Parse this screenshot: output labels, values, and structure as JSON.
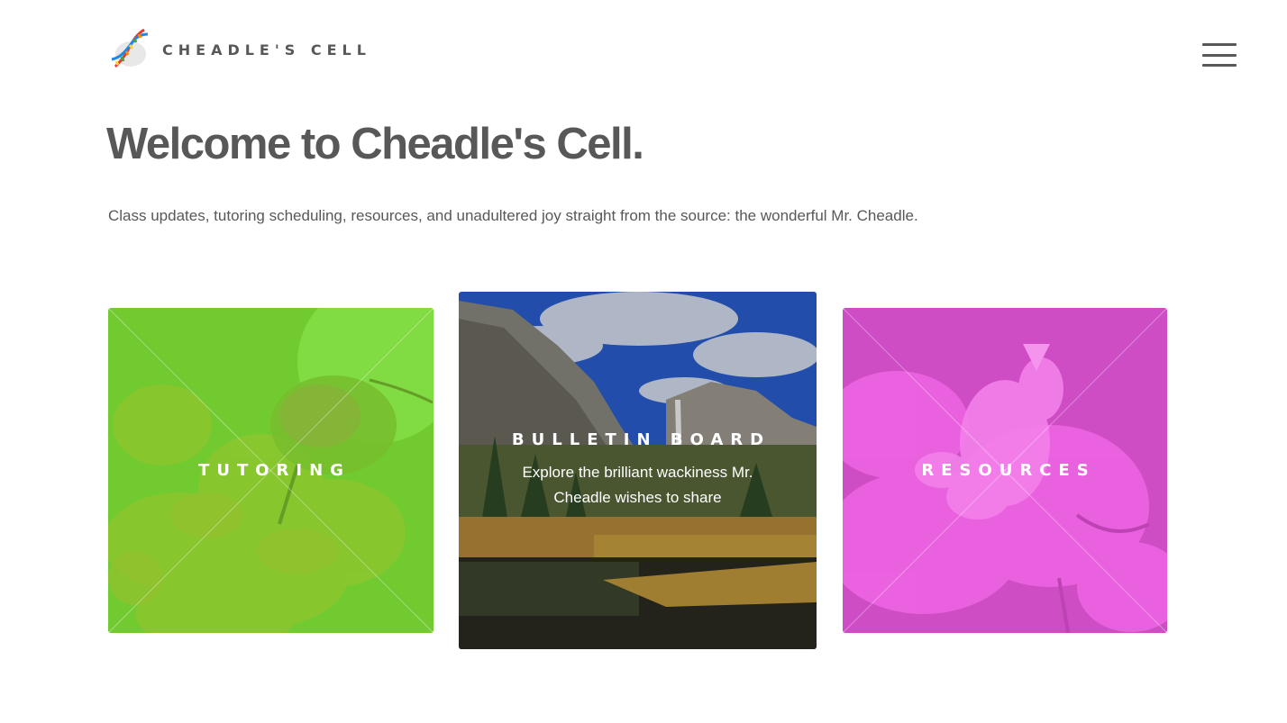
{
  "site": {
    "logo_icon": "dna-helix-icon",
    "name": "CHEADLE'S CELL",
    "menu_icon": "hamburger-menu-icon"
  },
  "hero": {
    "title": "Welcome to Cheadle's Cell.",
    "intro": "Class updates, tutoring scheduling, resources, and unadultered joy straight from the source: the wonderful Mr. Cheadle."
  },
  "tiles": [
    {
      "title": "TUTORING",
      "description": "",
      "tint": "#7ddc3c",
      "image": "bee-on-flower"
    },
    {
      "title": "BULLETIN BOARD",
      "description": "Explore the brilliant wackiness Mr. Cheadle wishes to share",
      "tint": "",
      "image": "yosemite-waterfall"
    },
    {
      "title": "RESOURCES",
      "description": "",
      "tint": "#e64fd8",
      "image": "orchid-mantis"
    }
  ]
}
